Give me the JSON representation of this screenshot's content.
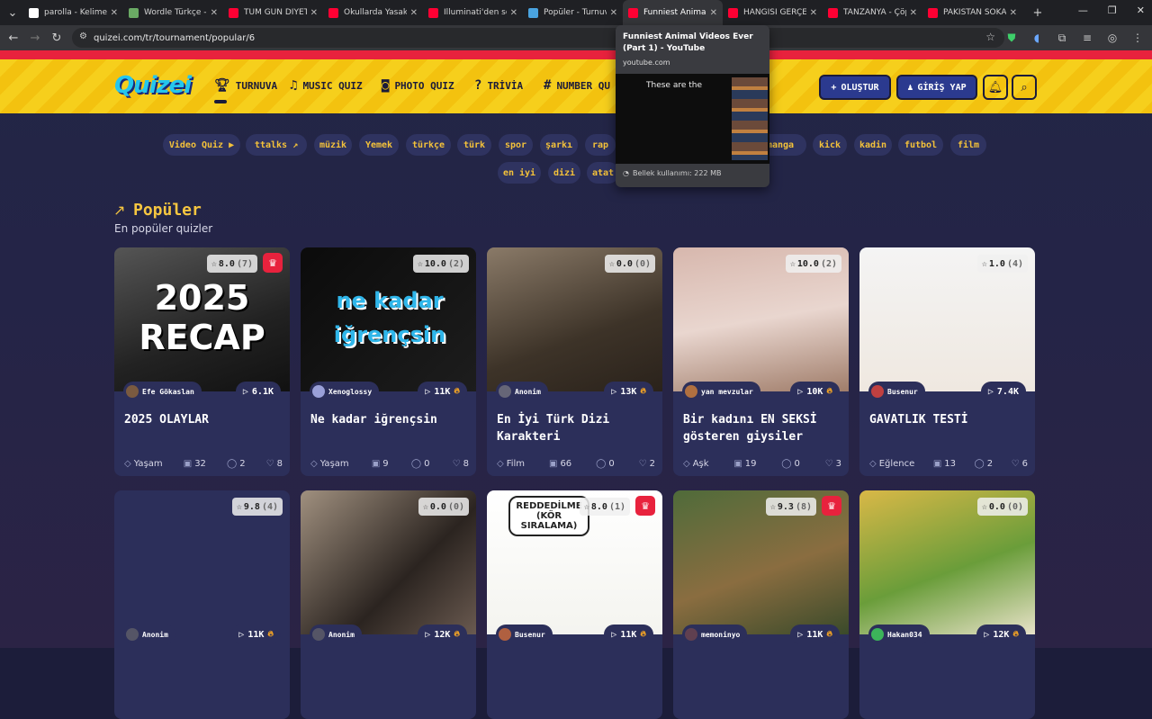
{
  "tabs": [
    {
      "title": "parolla - Kelime o",
      "color": "#ffffff"
    },
    {
      "title": "Wordle Türkçe - G",
      "color": "#6aaa64"
    },
    {
      "title": "TÜM GÜN DİYET",
      "color": "#ff0033"
    },
    {
      "title": "Okullarda Yasakla",
      "color": "#ff0033"
    },
    {
      "title": "İlluminati'den son",
      "color": "#ff0033"
    },
    {
      "title": "Popüler - Turnuva",
      "color": "#4aa3df"
    },
    {
      "title": "Funniest Animal V",
      "color": "#ff0033"
    },
    {
      "title": "HANGİSİ GERÇEK",
      "color": "#ff0033"
    },
    {
      "title": "TANZANYA - Çöp",
      "color": "#ff0033"
    },
    {
      "title": "PAKİSTAN SOKAK",
      "color": "#ff0033"
    }
  ],
  "browser": {
    "url": "quizei.com/tr/tournament/popular/6"
  },
  "tooltip": {
    "title": "Funniest Animal Videos Ever (Part 1) - YouTube",
    "url": "youtube.com",
    "caption": "These are the",
    "memory": "Bellek kullanımı: 222 MB"
  },
  "header": {
    "logo": "Quizei",
    "nav": [
      "TURNUVA",
      "MUSIC QUIZ",
      "PHOTO QUIZ",
      "TRİVİA",
      "NUMBER QU"
    ],
    "create": "OLUŞTUR",
    "login": "GİRİŞ YAP"
  },
  "chips_row1": [
    "Video Quiz ▶",
    "ttalks ↗",
    "müzik",
    "Yemek",
    "türkçe",
    "türk",
    "spor",
    "şarkı",
    "rap",
    "manga",
    "kick",
    "kadin",
    "futbol",
    "film"
  ],
  "chips_row2": [
    "en iyi",
    "dizi",
    "atat"
  ],
  "section": {
    "title": "Popüler",
    "subtitle": "En popüler quizler"
  },
  "cards": [
    {
      "rating": "8.0",
      "votes": "(7)",
      "crown": true,
      "author": "Efe Gökaslan",
      "plays": "6.1K",
      "fire": false,
      "title": "2025 OLAYLAR",
      "category": "Yaşam",
      "items": "32",
      "comments": "2",
      "likes": "8",
      "thumb_text": "2025 RECAP"
    },
    {
      "rating": "10.0",
      "votes": "(2)",
      "crown": false,
      "author": "Xenoglossy",
      "plays": "11K",
      "fire": true,
      "title": "Ne kadar iğrençsin",
      "category": "Yaşam",
      "items": "9",
      "comments": "0",
      "likes": "8",
      "thumb_text": "ne kadar iğrençsin"
    },
    {
      "rating": "0.0",
      "votes": "(0)",
      "crown": false,
      "author": "Anonim",
      "plays": "13K",
      "fire": true,
      "title": "En İyi Türk Dizi Karakteri",
      "category": "Film",
      "items": "66",
      "comments": "0",
      "likes": "2",
      "thumb_text": ""
    },
    {
      "rating": "10.0",
      "votes": "(2)",
      "crown": false,
      "author": "yan mevzular",
      "plays": "10K",
      "fire": true,
      "title": "Bir kadını EN SEKSİ gösteren giysiler",
      "category": "Aşk",
      "items": "19",
      "comments": "0",
      "likes": "3",
      "thumb_text": ""
    },
    {
      "rating": "1.0",
      "votes": "(4)",
      "crown": false,
      "author": "Busenur",
      "plays": "7.4K",
      "fire": false,
      "title": "GAVATLIK TESTİ",
      "category": "Eğlence",
      "items": "13",
      "comments": "2",
      "likes": "6",
      "thumb_text": ""
    },
    {
      "rating": "9.8",
      "votes": "(4)",
      "crown": false,
      "author": "Anonim",
      "plays": "11K",
      "fire": true,
      "title": "",
      "category": "",
      "items": "",
      "comments": "",
      "likes": "",
      "thumb_text": ""
    },
    {
      "rating": "0.0",
      "votes": "(0)",
      "crown": false,
      "author": "Anonim",
      "plays": "12K",
      "fire": true,
      "title": "",
      "category": "",
      "items": "",
      "comments": "",
      "likes": "",
      "thumb_text": ""
    },
    {
      "rating": "8.0",
      "votes": "(1)",
      "crown": true,
      "author": "Busenur",
      "plays": "11K",
      "fire": true,
      "title": "",
      "category": "",
      "items": "",
      "comments": "",
      "likes": "",
      "thumb_text": "REDDEDİLME (KÖR SIRALAMA)"
    },
    {
      "rating": "9.3",
      "votes": "(8)",
      "crown": true,
      "author": "memoninyo",
      "plays": "11K",
      "fire": true,
      "title": "",
      "category": "",
      "items": "",
      "comments": "",
      "likes": "",
      "thumb_text": ""
    },
    {
      "rating": "0.0",
      "votes": "(0)",
      "crown": false,
      "author": "Hakan034",
      "plays": "12K",
      "fire": true,
      "title": "",
      "category": "",
      "items": "",
      "comments": "",
      "likes": "",
      "thumb_text": ""
    }
  ]
}
